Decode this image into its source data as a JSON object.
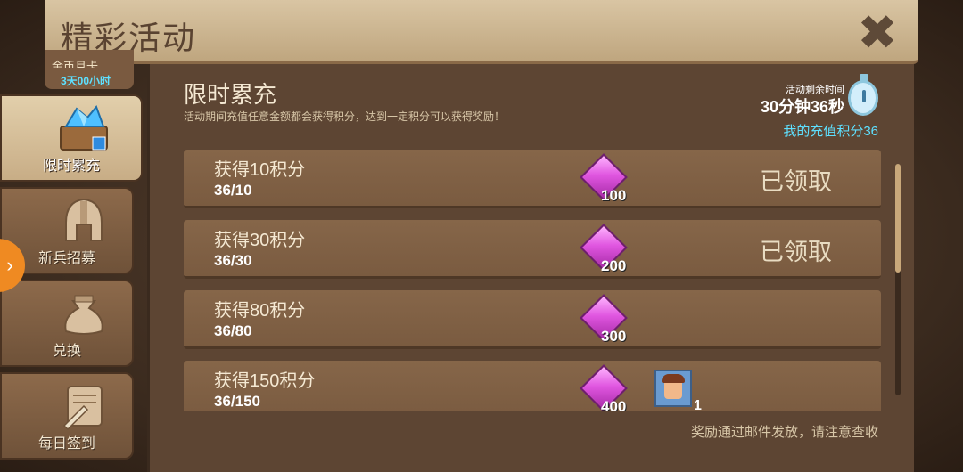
{
  "header": {
    "title": "精彩活动"
  },
  "tabs_top": {
    "line1": "金币月卡",
    "line2": "3天00小时"
  },
  "tabs": [
    {
      "label": "限时累充",
      "icon": "crystal-chest-icon",
      "active": true
    },
    {
      "label": "新兵招募",
      "icon": "helmet-icon",
      "active": false
    },
    {
      "label": "兑换",
      "icon": "money-bag-icon",
      "active": false
    },
    {
      "label": "每日签到",
      "icon": "scroll-quill-icon",
      "active": false
    }
  ],
  "panel": {
    "heading": "限时累充",
    "description": "活动期间充值任意金额都会获得积分，达到一定积分可以获得奖励！",
    "timer_label": "活动剩余时间",
    "timer_value": "30分钟36秒",
    "my_points": "我的充值积分36",
    "footer_note": "奖励通过邮件发放，请注意查收"
  },
  "rows": [
    {
      "title": "获得10积分",
      "progress": "36/10",
      "gem_amount": "100",
      "status": "已领取"
    },
    {
      "title": "获得30积分",
      "progress": "36/30",
      "gem_amount": "200",
      "status": "已领取"
    },
    {
      "title": "获得80积分",
      "progress": "36/80",
      "gem_amount": "300",
      "status": ""
    },
    {
      "title": "获得150积分",
      "progress": "36/150",
      "gem_amount": "400",
      "status": "",
      "extra_count": "1"
    }
  ],
  "colors": {
    "accent_cyan": "#5ee0ff",
    "gem": "#e056e0",
    "orange": "#ef8a22"
  }
}
